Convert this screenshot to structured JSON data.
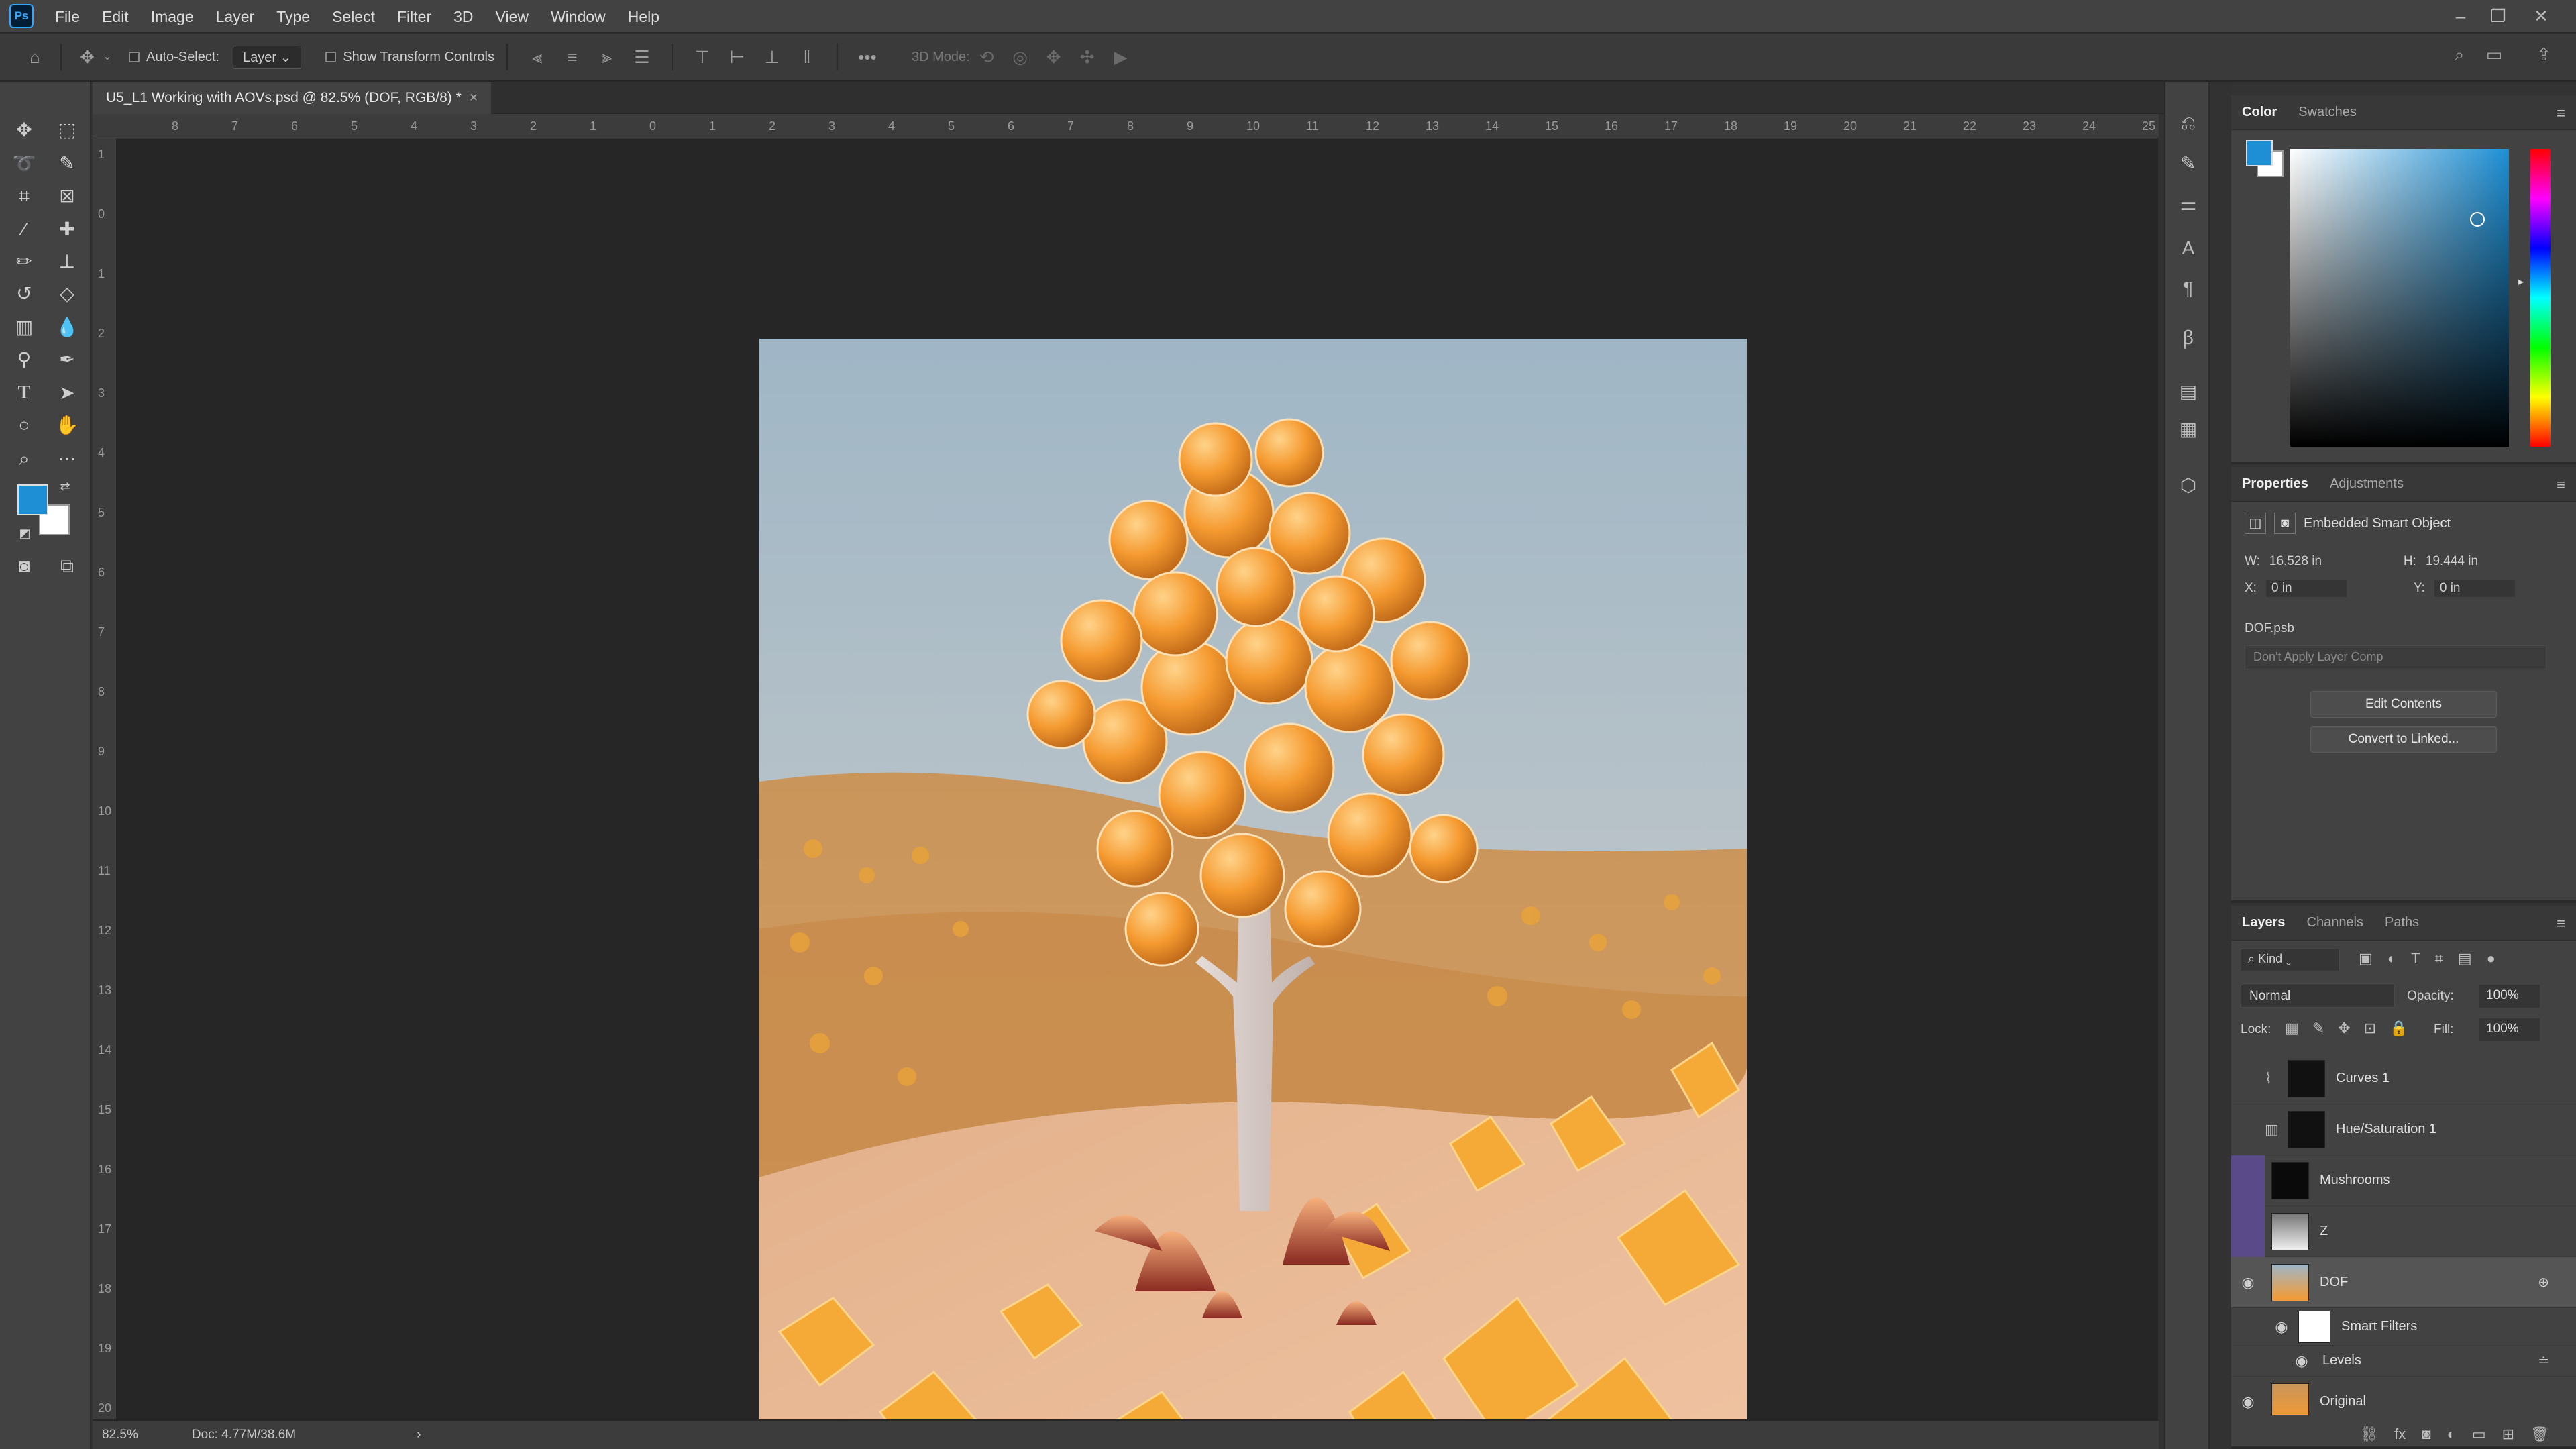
{
  "app": {
    "logo": "Ps",
    "menu": [
      "File",
      "Edit",
      "Image",
      "Layer",
      "Type",
      "Select",
      "Filter",
      "3D",
      "View",
      "Window",
      "Help"
    ]
  },
  "options": {
    "auto_select_label": "Auto-Select:",
    "auto_select_value": "Layer",
    "show_transform_label": "Show Transform Controls",
    "mode_3d_label": "3D Mode:"
  },
  "document": {
    "tab_title": "U5_L1 Working with AOVs.psd @ 82.5% (DOF, RGB/8) *",
    "close": "×"
  },
  "ruler": {
    "top": [
      "8",
      "7",
      "6",
      "5",
      "4",
      "3",
      "2",
      "1",
      "0",
      "1",
      "2",
      "3",
      "4",
      "5",
      "6",
      "7",
      "8",
      "9",
      "10",
      "11",
      "12",
      "13",
      "14",
      "15",
      "16",
      "17",
      "18",
      "19",
      "20",
      "21",
      "22",
      "23",
      "24",
      "25"
    ],
    "left": [
      "1",
      "0",
      "1",
      "2",
      "3",
      "4",
      "5",
      "6",
      "7",
      "8",
      "9",
      "10",
      "11",
      "12",
      "13",
      "14",
      "15",
      "16",
      "17",
      "18",
      "19",
      "20"
    ]
  },
  "status": {
    "zoom": "82.5%",
    "doc": "Doc: 4.77M/38.6M",
    "arrow": "›"
  },
  "color_panel": {
    "tabs": [
      "Color",
      "Swatches"
    ],
    "foreground": "#1e8fd4",
    "background": "#ffffff"
  },
  "properties_panel": {
    "tabs": [
      "Properties",
      "Adjustments"
    ],
    "type": "Embedded Smart Object",
    "w_label": "W:",
    "w_value": "16.528 in",
    "h_label": "H:",
    "h_value": "19.444 in",
    "x_label": "X:",
    "x_value": "0 in",
    "y_label": "Y:",
    "y_value": "0 in",
    "file": "DOF.psb",
    "layer_comp": "Don't Apply Layer Comp",
    "edit_contents": "Edit Contents",
    "convert_linked": "Convert to Linked..."
  },
  "layers_panel": {
    "tabs": [
      "Layers",
      "Channels",
      "Paths"
    ],
    "filter": "Kind",
    "blend_mode": "Normal",
    "opacity_label": "Opacity:",
    "opacity_value": "100%",
    "lock_label": "Lock:",
    "fill_label": "Fill:",
    "fill_value": "100%",
    "layers": [
      {
        "name": "Curves 1",
        "visible": false
      },
      {
        "name": "Hue/Saturation 1",
        "visible": false
      },
      {
        "name": "Mushrooms",
        "visible": false
      },
      {
        "name": "Z",
        "visible": false
      },
      {
        "name": "DOF",
        "visible": true
      },
      {
        "name": "Smart Filters",
        "visible": true
      },
      {
        "name": "Levels",
        "visible": true
      },
      {
        "name": "Original",
        "visible": true
      }
    ]
  }
}
